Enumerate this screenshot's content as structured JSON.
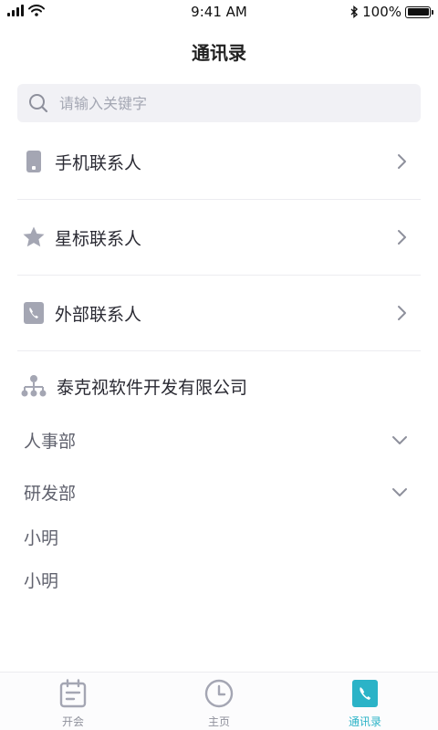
{
  "status_bar": {
    "time": "9:41 AM",
    "battery": "100%"
  },
  "header": {
    "title": "通讯录"
  },
  "search": {
    "placeholder": "请输入关键字",
    "value": ""
  },
  "contact_groups": [
    {
      "label": "手机联系人",
      "icon": "phone-icon"
    },
    {
      "label": "星标联系人",
      "icon": "star-icon"
    },
    {
      "label": "外部联系人",
      "icon": "contact-book-icon"
    }
  ],
  "organization": {
    "company": "泰克视软件开发有限公司",
    "icon": "org-chart-icon",
    "departments": [
      {
        "label": "人事部",
        "expanded": false
      },
      {
        "label": "研发部",
        "expanded": false
      }
    ],
    "members": [
      "小明",
      "小明"
    ]
  },
  "tab_bar": {
    "tabs": [
      {
        "label": "开会",
        "icon": "calendar-icon",
        "active": false
      },
      {
        "label": "主页",
        "icon": "clock-icon",
        "active": false
      },
      {
        "label": "通讯录",
        "icon": "contacts-icon",
        "active": true
      }
    ]
  },
  "colors": {
    "accent": "#2bb3c7",
    "icon_gray": "#a4a6b3",
    "divider": "#ececf0",
    "search_bg": "#f1f1f5"
  }
}
